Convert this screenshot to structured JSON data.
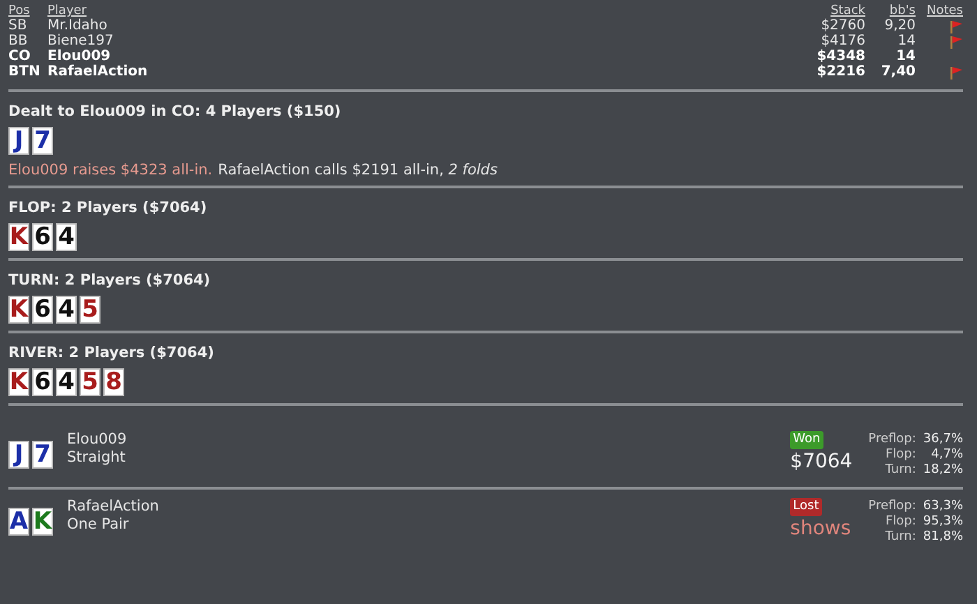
{
  "players_table": {
    "columns": [
      "Pos",
      "Player",
      "Stack",
      "bb's",
      "Notes"
    ],
    "rows": [
      {
        "pos": "SB",
        "player": "Mr.Idaho",
        "stack": "$2760",
        "bbs": "9,20",
        "has_note": true,
        "highlighted": false
      },
      {
        "pos": "BB",
        "player": "Biene197",
        "stack": "$4176",
        "bbs": "14",
        "has_note": true,
        "highlighted": false
      },
      {
        "pos": "CO",
        "player": "Elou009",
        "stack": "$4348",
        "bbs": "14",
        "has_note": false,
        "highlighted": true
      },
      {
        "pos": "BTN",
        "player": "RafaelAction",
        "stack": "$2216",
        "bbs": "7,40",
        "has_note": true,
        "highlighted": true
      }
    ]
  },
  "preflop": {
    "heading": "Dealt to Elou009 in CO: 4 Players ($150)",
    "cards": [
      {
        "rank": "J",
        "color": "#1c2fa8"
      },
      {
        "rank": "7",
        "color": "#1c2fa8"
      }
    ],
    "actions": [
      {
        "kind": "hero",
        "text": "Elou009 raises $4323 all-in."
      },
      {
        "kind": "other",
        "text": "RafaelAction calls $2191 all-in, *2 folds*"
      }
    ]
  },
  "streets": [
    {
      "heading": "FLOP: 2 Players ($7064)",
      "cards": [
        {
          "rank": "K",
          "color": "#a81c1c"
        },
        {
          "rank": "6",
          "color": "#111111"
        },
        {
          "rank": "4",
          "color": "#111111"
        }
      ]
    },
    {
      "heading": "TURN: 2 Players ($7064)",
      "cards": [
        {
          "rank": "K",
          "color": "#a81c1c"
        },
        {
          "rank": "6",
          "color": "#111111"
        },
        {
          "rank": "4",
          "color": "#111111"
        },
        {
          "rank": "5",
          "color": "#a81c1c"
        }
      ]
    },
    {
      "heading": "RIVER: 2 Players ($7064)",
      "cards": [
        {
          "rank": "K",
          "color": "#a81c1c"
        },
        {
          "rank": "6",
          "color": "#111111"
        },
        {
          "rank": "4",
          "color": "#111111"
        },
        {
          "rank": "5",
          "color": "#a81c1c"
        },
        {
          "rank": "8",
          "color": "#a81c1c"
        }
      ]
    }
  ],
  "results": [
    {
      "player": "Elou009",
      "hand": "Straight",
      "won": true,
      "badge": "Won",
      "amount": "$7064",
      "cards": [
        {
          "rank": "J",
          "color": "#1c2fa8"
        },
        {
          "rank": "7",
          "color": "#1c2fa8"
        }
      ],
      "equity": [
        {
          "label": "Preflop:",
          "value": "36,7%"
        },
        {
          "label": "Flop:",
          "value": "4,7%"
        },
        {
          "label": "Turn:",
          "value": "18,2%"
        }
      ]
    },
    {
      "player": "RafaelAction",
      "hand": "One Pair",
      "won": false,
      "badge": "Lost",
      "amount": "shows",
      "cards": [
        {
          "rank": "A",
          "color": "#1c2fa8"
        },
        {
          "rank": "K",
          "color": "#1d7a1d"
        }
      ],
      "equity": [
        {
          "label": "Preflop:",
          "value": "63,3%"
        },
        {
          "label": "Flop:",
          "value": "95,3%"
        },
        {
          "label": "Turn:",
          "value": "81,8%"
        }
      ]
    }
  ]
}
